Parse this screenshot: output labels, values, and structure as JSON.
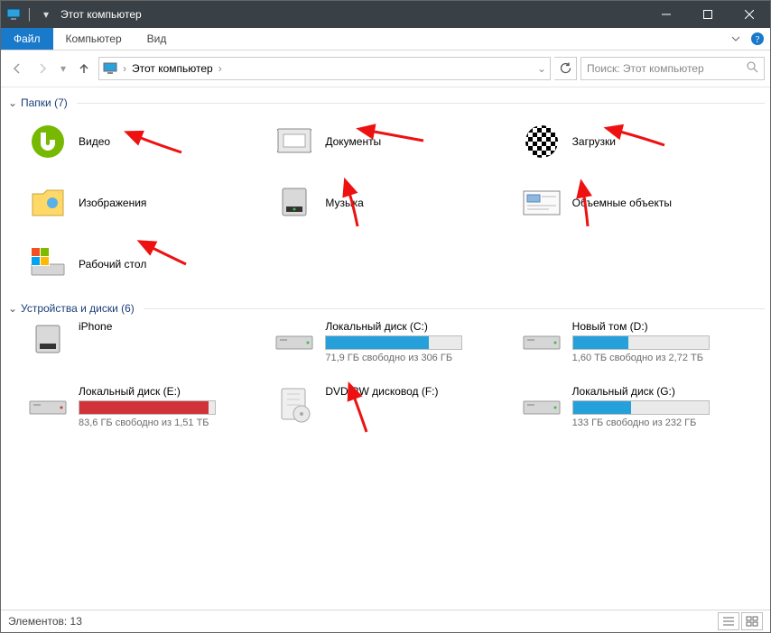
{
  "title": "Этот компьютер",
  "ribbon": {
    "file": "Файл",
    "computer": "Компьютер",
    "view": "Вид"
  },
  "address": {
    "location": "Этот компьютер",
    "search_placeholder": "Поиск: Этот компьютер"
  },
  "groups": {
    "folders": {
      "label": "Папки (7)",
      "items": [
        {
          "name": "Видео",
          "icon": "utorrent"
        },
        {
          "name": "Документы",
          "icon": "docs"
        },
        {
          "name": "Загрузки",
          "icon": "checker"
        },
        {
          "name": "Изображения",
          "icon": "pictures"
        },
        {
          "name": "Музыка",
          "icon": "serverbox"
        },
        {
          "name": "Объемные объекты",
          "icon": "mail"
        },
        {
          "name": "Рабочий стол",
          "icon": "drive-win"
        }
      ]
    },
    "drives": {
      "label": "Устройства и диски (6)",
      "items": [
        {
          "name": "iPhone",
          "icon": "graybox",
          "bar": null,
          "free": null
        },
        {
          "name": "Локальный диск (C:)",
          "icon": "drive",
          "bar": {
            "pct": 76,
            "color": "#26a0da"
          },
          "free": "71,9 ГБ свободно из 306 ГБ"
        },
        {
          "name": "Новый том (D:)",
          "icon": "drive",
          "bar": {
            "pct": 41,
            "color": "#26a0da"
          },
          "free": "1,60 ТБ свободно из 2,72 ТБ"
        },
        {
          "name": "Локальный диск (E:)",
          "icon": "drive-red",
          "bar": {
            "pct": 95,
            "color": "#d13438"
          },
          "free": "83,6 ГБ свободно из 1,51 ТБ"
        },
        {
          "name": "DVD RW дисковод (F:)",
          "icon": "disc",
          "bar": null,
          "free": null
        },
        {
          "name": "Локальный диск (G:)",
          "icon": "drive",
          "bar": {
            "pct": 43,
            "color": "#26a0da"
          },
          "free": "133 ГБ свободно из 232 ГБ"
        }
      ]
    }
  },
  "status": {
    "elements": "Элементов: 13"
  }
}
